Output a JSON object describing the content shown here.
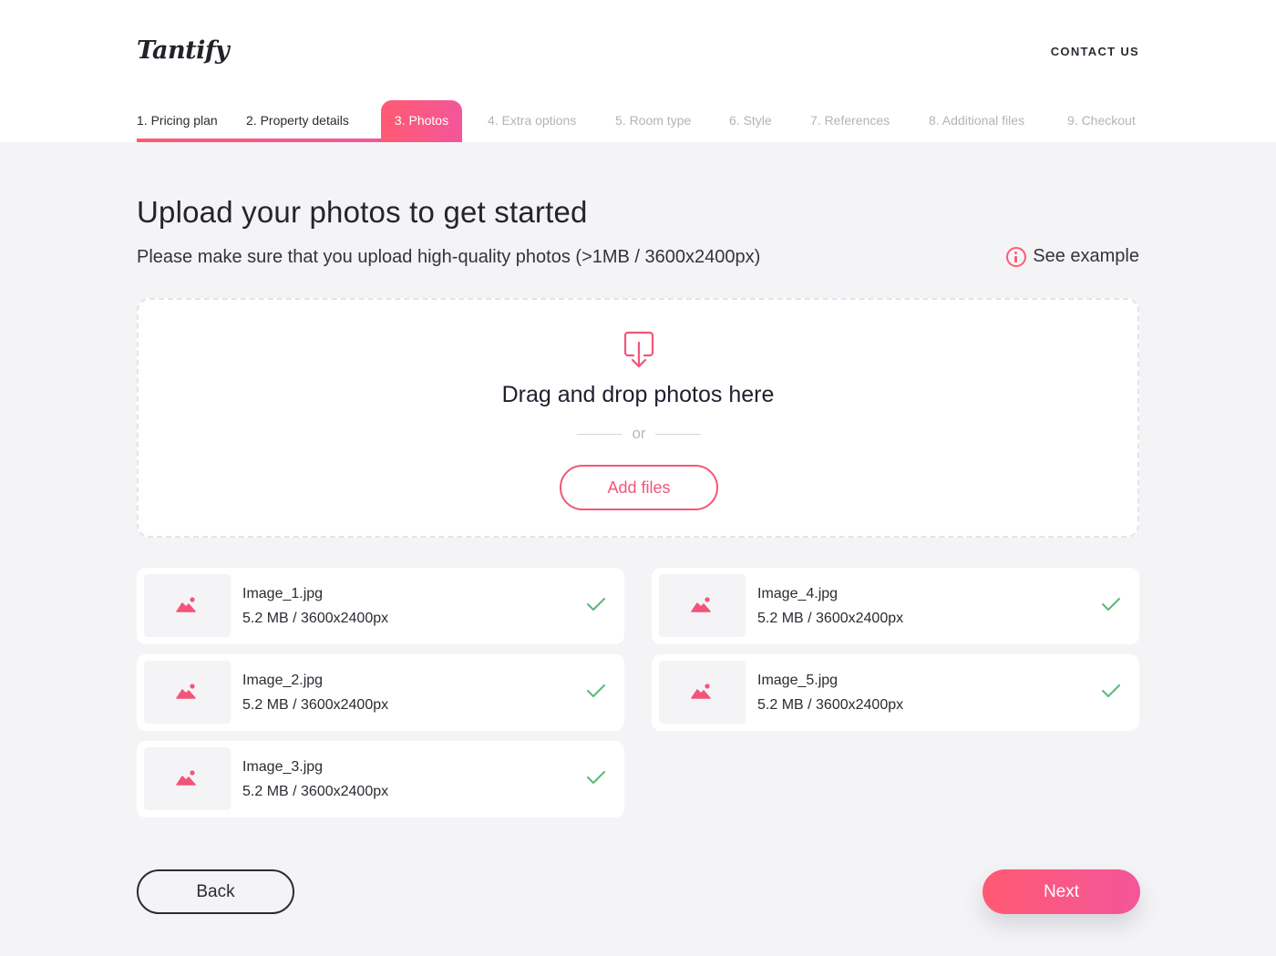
{
  "header": {
    "logo": "Tantify",
    "contact_label": "CONTACT US"
  },
  "steps": [
    {
      "label": "1. Pricing plan",
      "state": "done"
    },
    {
      "label": "2. Property details",
      "state": "done"
    },
    {
      "label": "3. Photos",
      "state": "active"
    },
    {
      "label": "4. Extra options",
      "state": "future"
    },
    {
      "label": "5. Room type",
      "state": "future"
    },
    {
      "label": "6. Style",
      "state": "future"
    },
    {
      "label": "7. References",
      "state": "future"
    },
    {
      "label": "8. Additional files",
      "state": "future"
    },
    {
      "label": "9. Checkout",
      "state": "future"
    }
  ],
  "main": {
    "title": "Upload your photos to get started",
    "subtitle": "Please make sure that you upload high-quality photos (>1MB / 3600x2400px)",
    "see_example": "See example"
  },
  "dropzone": {
    "text": "Drag and drop photos here",
    "or": "or",
    "add_files": "Add files"
  },
  "files": [
    {
      "name": "Image_1.jpg",
      "meta": "5.2 MB / 3600x2400px"
    },
    {
      "name": "Image_2.jpg",
      "meta": "5.2 MB / 3600x2400px"
    },
    {
      "name": "Image_3.jpg",
      "meta": "5.2 MB / 3600x2400px"
    },
    {
      "name": "Image_4.jpg",
      "meta": "5.2 MB / 3600x2400px"
    },
    {
      "name": "Image_5.jpg",
      "meta": "5.2 MB / 3600x2400px"
    }
  ],
  "footer": {
    "back": "Back",
    "next": "Next"
  },
  "colors": {
    "accent": "#ff5a72",
    "accent_end": "#f3569a",
    "check": "#5ab877",
    "background": "#f4f4f6"
  },
  "icons": {
    "upload": "download-tray-icon",
    "info": "info-circle-icon",
    "thumb": "image-icon",
    "check": "check-icon"
  }
}
